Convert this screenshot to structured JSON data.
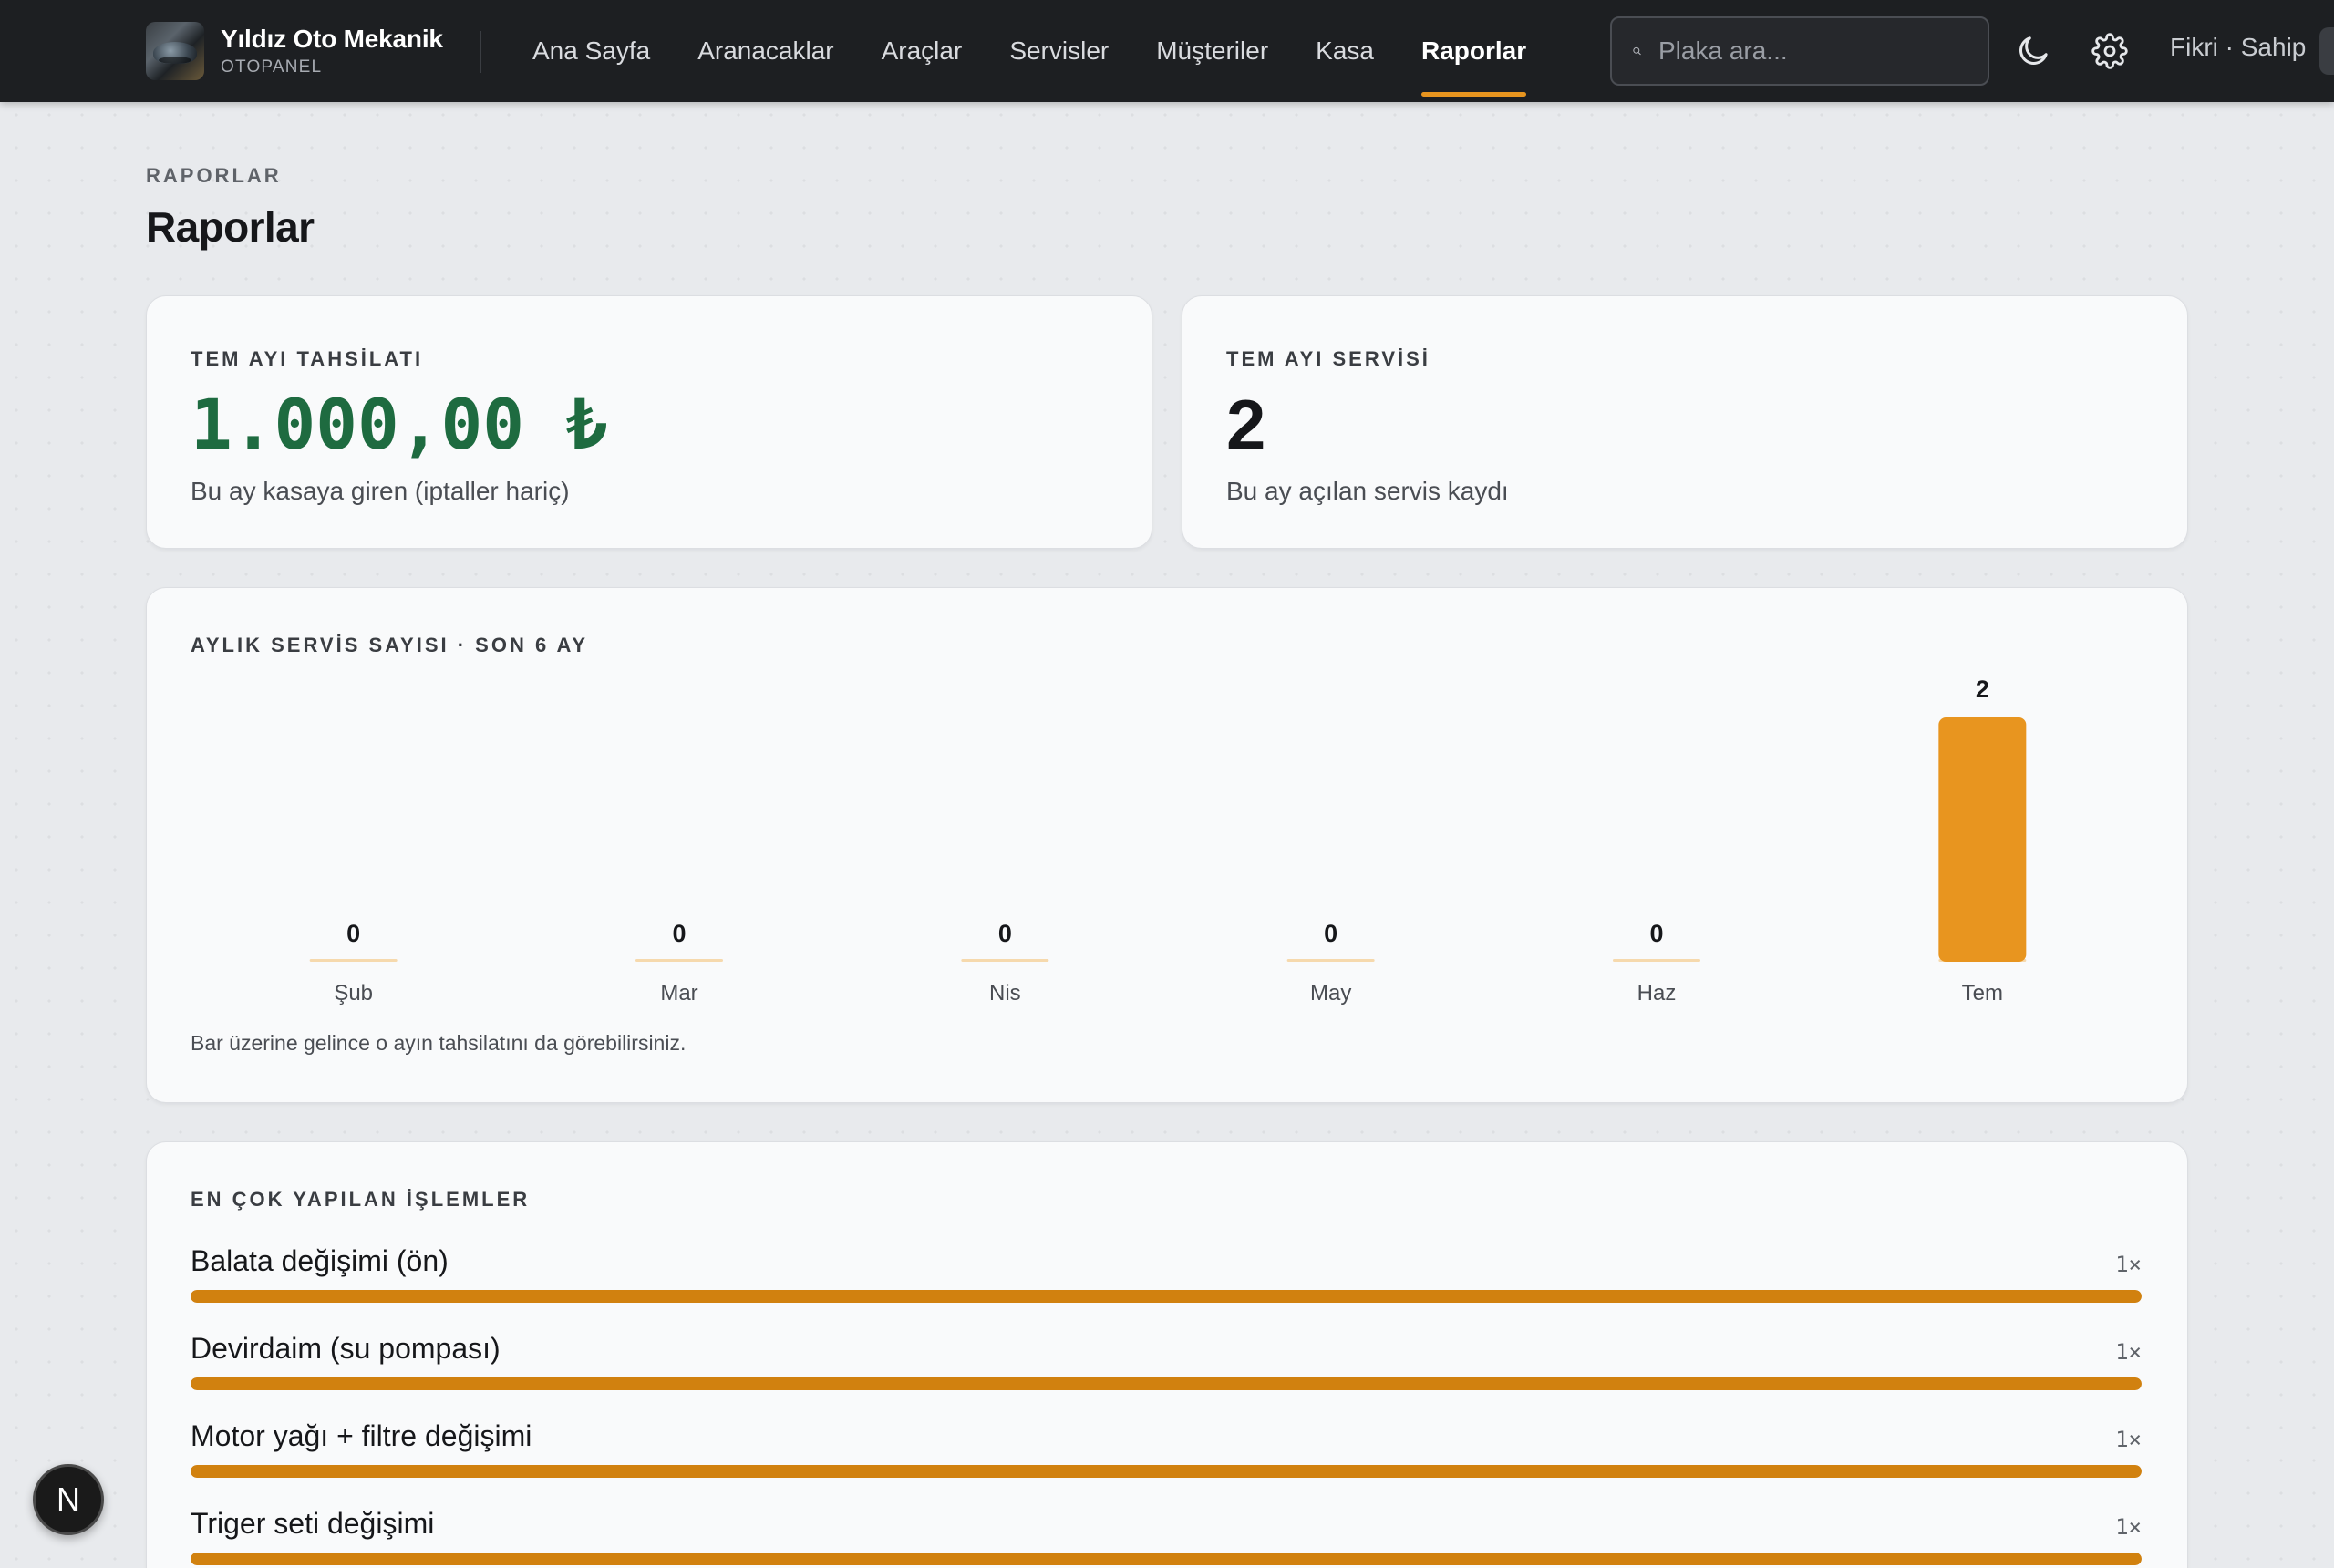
{
  "brand": {
    "name": "Yıldız Oto Mekanik",
    "sub": "OTOPANEL"
  },
  "nav": [
    {
      "label": "Ana Sayfa",
      "active": false
    },
    {
      "label": "Aranacaklar",
      "active": false
    },
    {
      "label": "Araçlar",
      "active": false
    },
    {
      "label": "Servisler",
      "active": false
    },
    {
      "label": "Müşteriler",
      "active": false
    },
    {
      "label": "Kasa",
      "active": false
    },
    {
      "label": "Raporlar",
      "active": true
    }
  ],
  "search": {
    "placeholder": "Plaka ara...",
    "icon": "search-icon"
  },
  "header_icons": [
    "moon-icon",
    "gear-icon"
  ],
  "user": {
    "label": "Fikri · Sahip"
  },
  "page": {
    "eyebrow": "RAPORLAR",
    "title": "Raporlar"
  },
  "stats": {
    "tahsilat": {
      "label": "TEM AYI TAHSİLATI",
      "value": "1.000,00 ₺",
      "desc": "Bu ay kasaya giren (iptaller hariç)"
    },
    "servis": {
      "label": "TEM AYI SERVİSİ",
      "value": "2",
      "desc": "Bu ay açılan servis kaydı"
    }
  },
  "chart": {
    "label": "AYLIK SERVİS SAYISI · SON 6 AY",
    "note": "Bar üzerine gelince o ayın tahsilatını da görebilirsiniz."
  },
  "chart_data": {
    "type": "bar",
    "title": "AYLIK SERVİS SAYISI · SON 6 AY",
    "categories": [
      "Şub",
      "Mar",
      "Nis",
      "May",
      "Haz",
      "Tem"
    ],
    "values": [
      0,
      0,
      0,
      0,
      0,
      2
    ],
    "ylim": [
      0,
      2
    ],
    "xlabel": "",
    "ylabel": "",
    "grid": false,
    "bar_color": "#e8951f",
    "baseline_color": "#f6d9ad"
  },
  "ops": {
    "label": "EN ÇOK YAPILAN İŞLEMLER",
    "items": [
      {
        "name": "Balata değişimi (ön)",
        "count": "1×",
        "ratio": 1
      },
      {
        "name": "Devirdaim (su pompası)",
        "count": "1×",
        "ratio": 1
      },
      {
        "name": "Motor yağı + filtre değişimi",
        "count": "1×",
        "ratio": 1
      },
      {
        "name": "Triger seti değişimi",
        "count": "1×",
        "ratio": 1
      }
    ]
  },
  "colors": {
    "accent": "#e8951f",
    "money": "#1e6b40",
    "nav_bg": "#1d1f22",
    "op_bar": "#d1810f"
  },
  "badge": {
    "label": "N"
  }
}
